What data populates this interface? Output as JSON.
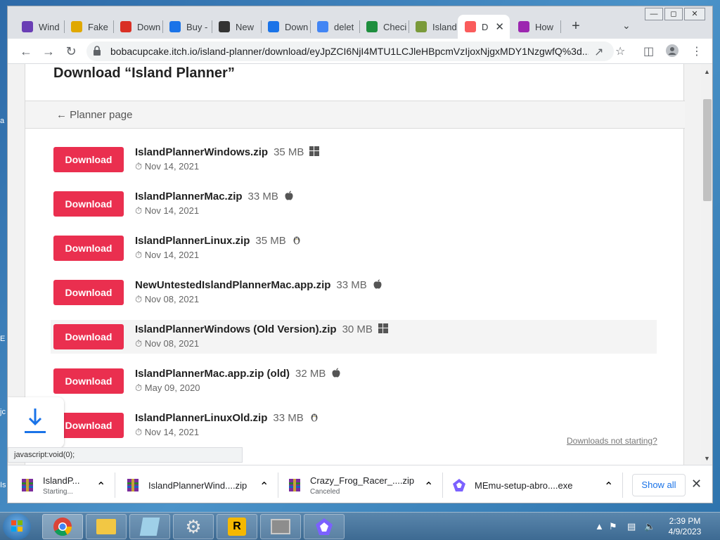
{
  "browser": {
    "tabs": [
      {
        "label": "Wind",
        "icon": "game-controller-icon",
        "color": "#6a3fb5"
      },
      {
        "label": "Fake",
        "icon": "sticker-icon",
        "color": "#e0a800"
      },
      {
        "label": "Down",
        "icon": "download-site-icon",
        "color": "#d93025"
      },
      {
        "label": "Buy -",
        "icon": "store-icon",
        "color": "#1a73e8"
      },
      {
        "label": "New",
        "icon": "github-icon",
        "color": "#333333"
      },
      {
        "label": "Down",
        "icon": "download-arrow-icon",
        "color": "#1a73e8"
      },
      {
        "label": "delet",
        "icon": "google-icon",
        "color": "#4285f4"
      },
      {
        "label": "Checi",
        "icon": "leaf-icon",
        "color": "#1e8e3e"
      },
      {
        "label": "Island",
        "icon": "island-icon",
        "color": "#7a9a3a"
      },
      {
        "label": "D",
        "icon": "itch-io-icon",
        "color": "#fa5c5c",
        "active": true
      },
      {
        "label": "How",
        "icon": "colorful-flower-icon",
        "color": "#9c27b0"
      }
    ],
    "new_tab_label": "+",
    "url": "bobacupcake.itch.io/island-planner/download/eyJpZCI6NjI4MTU1LCJleHBpcmVzIjoxNjgxMDY1NzgwfQ%3d..."
  },
  "page": {
    "title": "Download “Island Planner”",
    "back_link": "← Planner page",
    "download_label": "Download",
    "files": [
      {
        "name": "IslandPlannerWindows.zip",
        "size": "35 MB",
        "date": "Nov 14, 2021",
        "os": "windows"
      },
      {
        "name": "IslandPlannerMac.zip",
        "size": "33 MB",
        "date": "Nov 14, 2021",
        "os": "apple"
      },
      {
        "name": "IslandPlannerLinux.zip",
        "size": "35 MB",
        "date": "Nov 14, 2021",
        "os": "linux"
      },
      {
        "name": "NewUntestedIslandPlannerMac.app.zip",
        "size": "33 MB",
        "date": "Nov 08, 2021",
        "os": "apple"
      },
      {
        "name": "IslandPlannerWindows (Old Version).zip",
        "size": "30 MB",
        "date": "Nov 08, 2021",
        "os": "windows",
        "hover": true
      },
      {
        "name": "IslandPlannerMac.app.zip (old)",
        "size": "32 MB",
        "date": "May 09, 2020",
        "os": "apple"
      },
      {
        "name": "IslandPlannerLinuxOld.zip",
        "size": "33 MB",
        "date": "Nov 14, 2021",
        "os": "linux"
      }
    ],
    "not_starting": "Downloads not starting?"
  },
  "status_tip": "javascript:void(0);",
  "shelf": {
    "items": [
      {
        "name": "IslandP...",
        "status": "Starting..."
      },
      {
        "name": "IslandPlannerWind....zip",
        "status": ""
      },
      {
        "name": "Crazy_Frog_Racer_....zip",
        "status": "Canceled"
      },
      {
        "name": "MEmu-setup-abro....exe",
        "status": ""
      }
    ],
    "show_all": "Show all"
  },
  "taskbar": {
    "time": "2:39 PM",
    "date": "4/9/2023"
  }
}
